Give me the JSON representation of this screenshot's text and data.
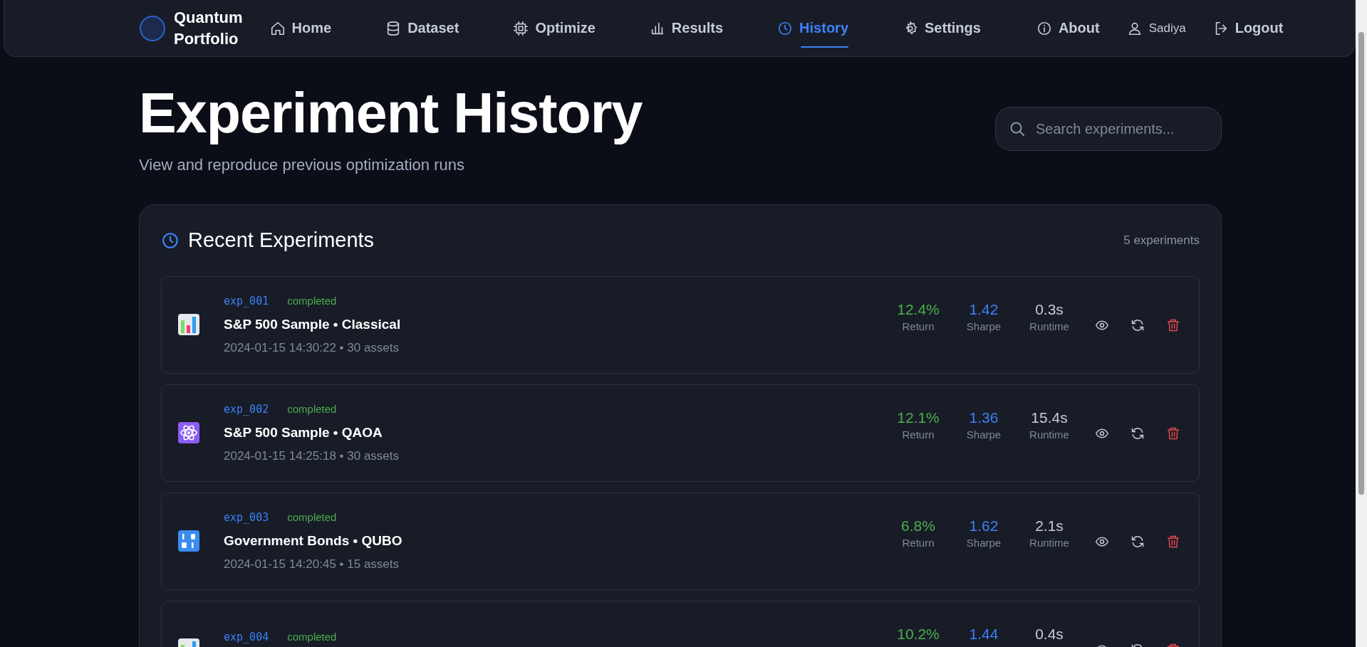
{
  "brand": {
    "line1": "Quantum",
    "line2": "Portfolio"
  },
  "nav": [
    {
      "label": "Home",
      "selected": false
    },
    {
      "label": "Dataset",
      "selected": false
    },
    {
      "label": "Optimize",
      "selected": false
    },
    {
      "label": "Results",
      "selected": false
    },
    {
      "label": "History",
      "selected": true
    },
    {
      "label": "Settings",
      "selected": false
    }
  ],
  "user_nav": {
    "about": "About",
    "user": "Sadiya",
    "logout": "Logout"
  },
  "header": {
    "title": "Experiment History",
    "subtitle": "View and reproduce previous optimization runs"
  },
  "search": {
    "placeholder": "Search experiments..."
  },
  "panel": {
    "title": "Recent Experiments",
    "count": "5 experiments"
  },
  "experiments": [
    {
      "kind": "chart",
      "id": "exp_001",
      "status": "completed",
      "title": "S&P 500 Sample • Classical",
      "meta": "2024-01-15 14:30:22 • 30 assets",
      "return": "12.4%",
      "return_label": "Return",
      "sharpe": "1.42",
      "sharpe_label": "Sharpe",
      "runtime": "0.3s",
      "runtime_label": "Runtime"
    },
    {
      "kind": "atom",
      "id": "exp_002",
      "status": "completed",
      "title": "S&P 500 Sample • QAOA",
      "meta": "2024-01-15 14:25:18 • 30 assets",
      "return": "12.1%",
      "return_label": "Return",
      "sharpe": "1.36",
      "sharpe_label": "Sharpe",
      "runtime": "15.4s",
      "runtime_label": "Runtime"
    },
    {
      "kind": "numbers",
      "id": "exp_003",
      "status": "completed",
      "title": "Government Bonds • QUBO",
      "meta": "2024-01-15 14:20:45 • 15 assets",
      "return": "6.8%",
      "return_label": "Return",
      "sharpe": "1.62",
      "sharpe_label": "Sharpe",
      "runtime": "2.1s",
      "runtime_label": "Runtime"
    },
    {
      "kind": "chart",
      "id": "exp_004",
      "status": "completed",
      "return": "10.2%",
      "sharpe": "1.44",
      "runtime": "0.4s"
    }
  ]
}
